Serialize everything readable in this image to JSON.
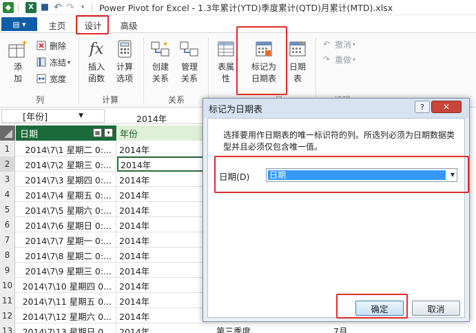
{
  "window": {
    "title": "Power Pivot for Excel - 1.3年累计(YTD)季度累计(QTD)月累计(MTD).xlsx"
  },
  "tabs": {
    "file_label": "",
    "home": "主页",
    "design": "设计",
    "advanced": "高级"
  },
  "ribbon": {
    "columns_group": {
      "label": "列",
      "add": "添\n加",
      "delete": "删除",
      "freeze": "冻结",
      "width": "宽度"
    },
    "calc_group": {
      "label": "计算",
      "insert_function": "插入\n函数",
      "calc_options": "计算\n选项"
    },
    "relations_group": {
      "label": "关系",
      "create_relation": "创建\n关系",
      "manage_relation": "管理\n关系"
    },
    "table_properties": "表属\n性",
    "mark_date_table": "标记为\n日期表",
    "date_table": "日期\n表",
    "undo": "撤消",
    "redo": "重做",
    "partial_label_1": "日",
    "partial_label_2": "编辑"
  },
  "namebox": {
    "value": "[年份]",
    "formula_value": "2014年"
  },
  "grid": {
    "col_date": "日期",
    "col_year": "年份",
    "rows": [
      {
        "n": "1",
        "date": "2014\\7\\1 星期二 0:...",
        "year": "2014年"
      },
      {
        "n": "2",
        "date": "2014\\7\\2 星期三 0:...",
        "year": "2014年"
      },
      {
        "n": "3",
        "date": "2014\\7\\3 星期四 0:...",
        "year": "2014年"
      },
      {
        "n": "4",
        "date": "2014\\7\\4 星期五 0:...",
        "year": "2014年"
      },
      {
        "n": "5",
        "date": "2014\\7\\5 星期六 0:...",
        "year": "2014年"
      },
      {
        "n": "6",
        "date": "2014\\7\\6 星期日 0:...",
        "year": "2014年"
      },
      {
        "n": "7",
        "date": "2014\\7\\7 星期一 0:...",
        "year": "2014年"
      },
      {
        "n": "8",
        "date": "2014\\7\\8 星期二 0:...",
        "year": "2014年"
      },
      {
        "n": "9",
        "date": "2014\\7\\9 星期三 0:...",
        "year": "2014年"
      },
      {
        "n": "10",
        "date": "2014\\7\\10 星期四 0...",
        "year": "2014年"
      },
      {
        "n": "11",
        "date": "2014\\7\\11 星期五 0...",
        "year": "2014年"
      },
      {
        "n": "12",
        "date": "2014\\7\\12 星期六 0...",
        "year": "2014年"
      },
      {
        "n": "13",
        "date": "2014\\7\\13 星期日 0...",
        "year": "2014年"
      }
    ],
    "extra_quarter": "第三季度",
    "extra_month": "7月"
  },
  "dialog": {
    "title": "标记为日期表",
    "help": "?",
    "close": "✕",
    "description": "选择要用作日期表的唯一标识符的列。所选列必须为日期数据类型并且必须仅包含唯一值。",
    "field_label": "日期(D)",
    "field_value": "日期",
    "ok": "确定",
    "cancel": "取消"
  },
  "colors": {
    "accent_red": "#e02a2a",
    "header_green": "#1b6a3a",
    "select_blue": "#3399ff"
  }
}
